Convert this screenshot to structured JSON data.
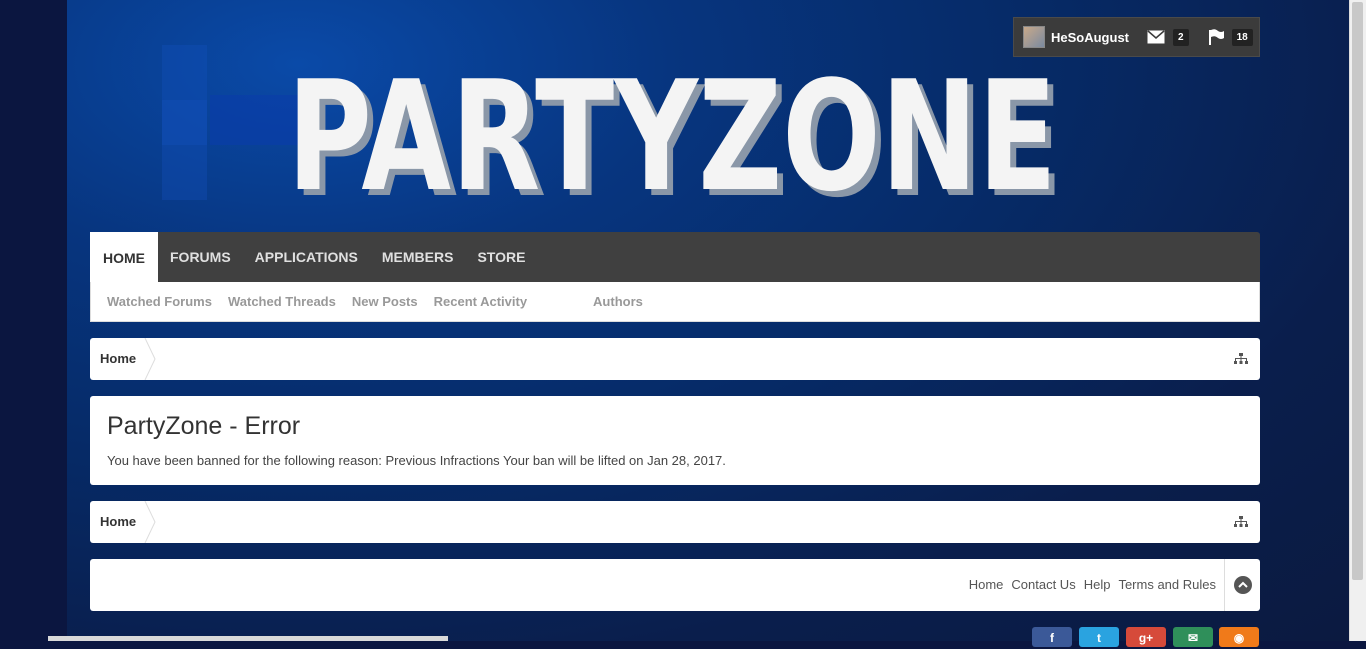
{
  "userbar": {
    "username": "HeSoAugust",
    "inbox_count": "2",
    "alerts_count": "18"
  },
  "logo": {
    "text": "PARTYZONE"
  },
  "nav": {
    "tabs": [
      "HOME",
      "FORUMS",
      "APPLICATIONS",
      "MEMBERS",
      "STORE"
    ],
    "sublinks": [
      "Watched Forums",
      "Watched Threads",
      "New Posts",
      "Recent Activity",
      "Authors"
    ]
  },
  "breadcrumb": {
    "home": "Home"
  },
  "error": {
    "title": "PartyZone - Error",
    "message": "You have been banned for the following reason: Previous Infractions Your ban will be lifted on Jan 28, 2017."
  },
  "footer": {
    "links": [
      "Home",
      "Contact Us",
      "Help",
      "Terms and Rules"
    ]
  },
  "colors": {
    "navbar": "#404040",
    "background": "#062a66",
    "accent_red": "#d64a3a",
    "accent_orange": "#f07a1a"
  }
}
